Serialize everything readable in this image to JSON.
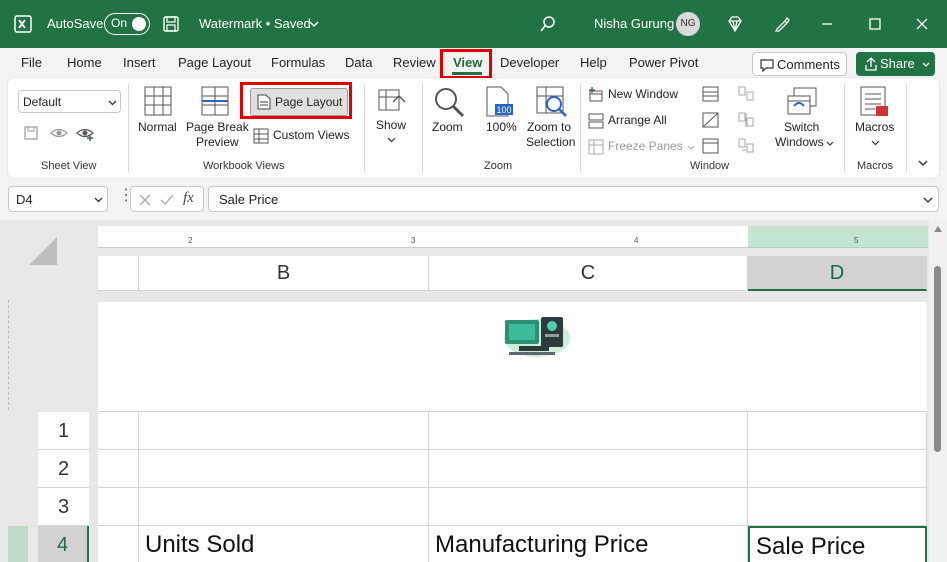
{
  "titlebar": {
    "autosave_label": "AutoSave",
    "toggle_label": "On",
    "doc_title": "Watermark • Saved",
    "user_name": "Nisha Gurung",
    "user_initials": "NG",
    "accent": "#217346"
  },
  "tabs": [
    "File",
    "Home",
    "Insert",
    "Page Layout",
    "Formulas",
    "Data",
    "Review",
    "View",
    "Developer",
    "Help",
    "Power Pivot"
  ],
  "active_tab": "View",
  "comments_label": "Comments",
  "share_label": "Share",
  "ribbon": {
    "sheet_view": {
      "dropdown_value": "Default",
      "group_label": "Sheet View"
    },
    "workbook_views": {
      "normal": "Normal",
      "page_break_1": "Page Break",
      "page_break_2": "Preview",
      "page_layout": "Page Layout",
      "custom_views": "Custom Views",
      "group_label": "Workbook Views"
    },
    "show": {
      "label": "Show"
    },
    "zoom": {
      "zoom": "Zoom",
      "hundred": "100%",
      "zoom_sel_1": "Zoom to",
      "zoom_sel_2": "Selection",
      "group_label": "Zoom"
    },
    "window": {
      "new_window": "New Window",
      "arrange_all": "Arrange All",
      "freeze_panes": "Freeze Panes",
      "switch_1": "Switch",
      "switch_2": "Windows",
      "group_label": "Window"
    },
    "macros": {
      "label": "Macros",
      "group_label": "Macros"
    }
  },
  "formula_bar": {
    "name_box": "D4",
    "fx": "fx",
    "content": "Sale Price"
  },
  "sheet": {
    "ruler_ticks": [
      "2",
      "3",
      "4",
      "5"
    ],
    "columns": [
      "B",
      "C",
      "D"
    ],
    "rows": [
      "1",
      "2",
      "3",
      "4"
    ],
    "row4": {
      "b": "Units Sold",
      "c": "Manufacturing Price",
      "d": "Sale Price"
    }
  }
}
